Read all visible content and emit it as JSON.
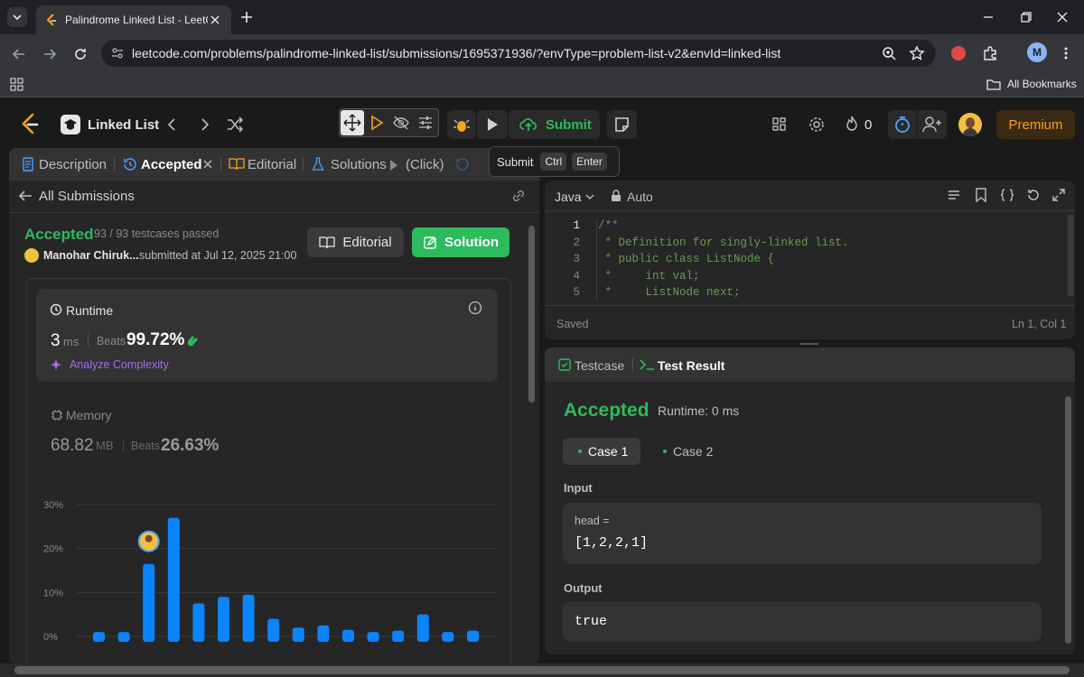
{
  "browser": {
    "tab_title": "Palindrome Linked List - LeetCode",
    "url": "leetcode.com/problems/palindrome-linked-list/submissions/1695371936/?envType=problem-list-v2&envId=linked-list",
    "all_bookmarks": "All Bookmarks",
    "profile_initial": "M"
  },
  "header": {
    "list_name": "Linked List",
    "submit_label": "Submit",
    "streak_count": "0",
    "premium_label": "Premium"
  },
  "tooltip": {
    "label": "Submit",
    "key1": "Ctrl",
    "key2": "Enter"
  },
  "left_tabs": {
    "description": "Description",
    "accepted": "Accepted",
    "editorial": "Editorial",
    "solutions": "Solutions",
    "click": "(Click)"
  },
  "submission": {
    "back_label": "All Submissions",
    "status": "Accepted",
    "testcases": "93 / 93 testcases passed",
    "user": "Manohar Chiruk...",
    "submitted_at": "submitted at Jul 12, 2025 21:00",
    "editorial_btn": "Editorial",
    "solution_btn": "Solution"
  },
  "runtime": {
    "label": "Runtime",
    "value": "3",
    "unit": "ms",
    "beats_label": "Beats",
    "beats_value": "99.72%",
    "analyze": "Analyze Complexity"
  },
  "memory": {
    "label": "Memory",
    "value": "68.82",
    "unit": "MB",
    "beats_label": "Beats",
    "beats_value": "26.63%"
  },
  "chart_data": {
    "type": "bar",
    "title": "",
    "xlabel": "",
    "ylabel": "",
    "y_ticks": [
      "30%",
      "20%",
      "10%",
      "0%"
    ],
    "ylim": [
      0,
      30
    ],
    "values": [
      1,
      1,
      16.5,
      27,
      7.5,
      9,
      9.5,
      4,
      2,
      2.5,
      1.5,
      1,
      1.3,
      5,
      1,
      1.3
    ],
    "user_bar_index": 2,
    "bar_color": "#0a84ff"
  },
  "editor": {
    "language": "Java",
    "mode": "Auto",
    "status": "Saved",
    "cursor": "Ln 1, Col 1",
    "lines": [
      {
        "n": "1",
        "text": "/**"
      },
      {
        "n": "2",
        "text": " * Definition for singly-linked list."
      },
      {
        "n": "3",
        "text": " * public class ListNode {"
      },
      {
        "n": "4",
        "text": " *     int val;"
      },
      {
        "n": "5",
        "text": " *     ListNode next;"
      }
    ]
  },
  "result_panel": {
    "tab_testcase": "Testcase",
    "tab_result": "Test Result",
    "status": "Accepted",
    "runtime": "Runtime: 0 ms",
    "case1": "Case 1",
    "case2": "Case 2",
    "input_label": "Input",
    "input_var": "head =",
    "input_value": "[1,2,2,1]",
    "output_label": "Output",
    "output_value": "true"
  }
}
